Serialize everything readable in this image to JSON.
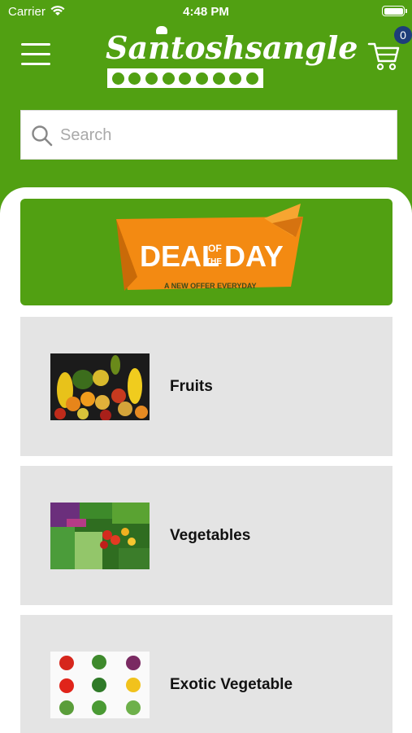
{
  "status_bar": {
    "carrier": "Carrier",
    "time": "4:48 PM"
  },
  "header": {
    "logo_text": "Santoshsangle",
    "cart_count": "0",
    "brand_color": "#51a012",
    "badge_color": "#1d3d7a"
  },
  "search": {
    "placeholder": "Search"
  },
  "deal_banner": {
    "title_left": "DEAL",
    "title_mid_top": "OF",
    "title_mid_bottom": "THE",
    "title_right": "DAY",
    "subtitle": "A NEW OFFER EVERYDAY"
  },
  "categories": [
    {
      "label": "Fruits",
      "icon": "fruits-image"
    },
    {
      "label": "Vegetables",
      "icon": "vegetables-image"
    },
    {
      "label": "Exotic Vegetable",
      "icon": "exotic-vegetable-image"
    }
  ]
}
